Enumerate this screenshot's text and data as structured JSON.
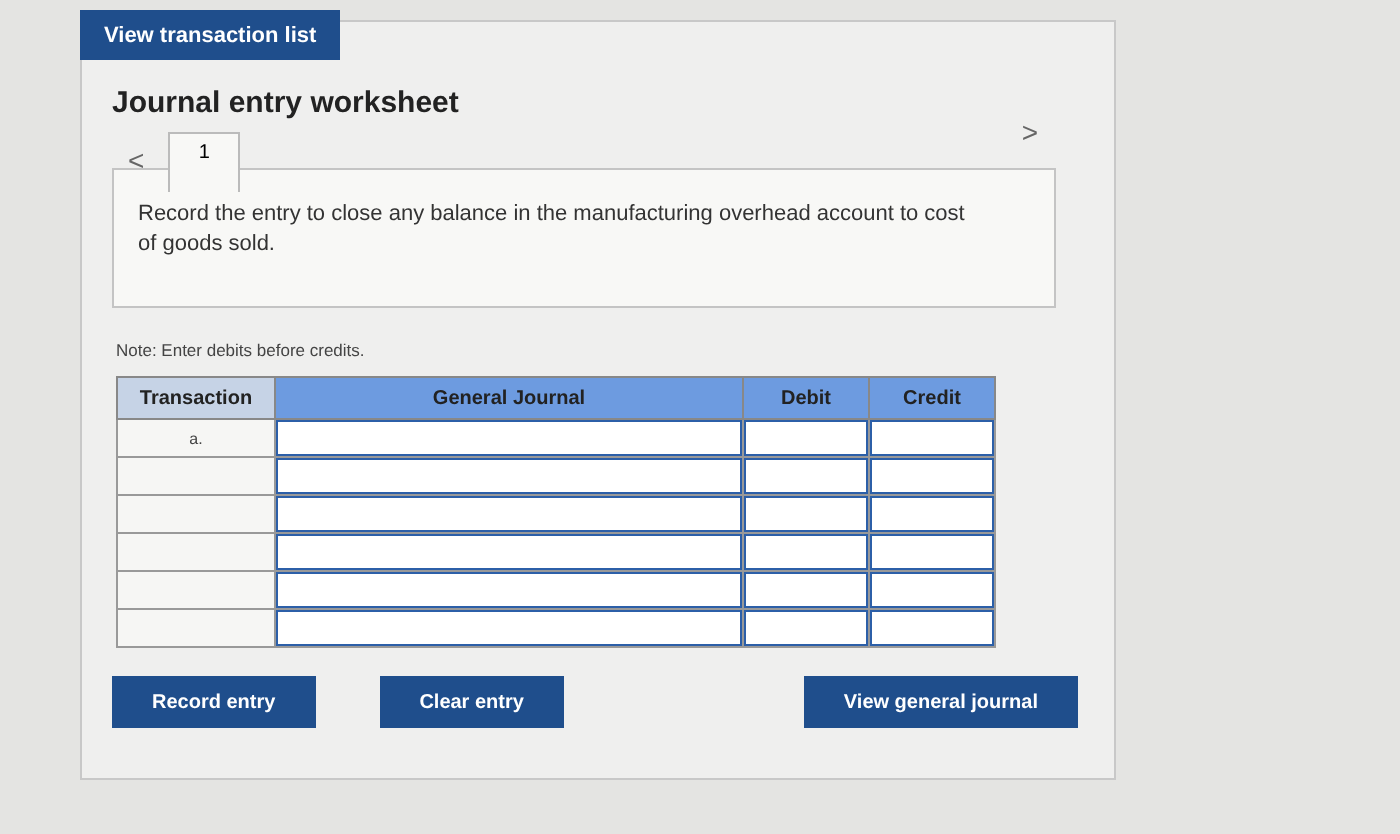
{
  "top_button": "View transaction list",
  "worksheet": {
    "title": "Journal entry worksheet",
    "prev": "<",
    "next": ">",
    "tabs": [
      {
        "label": "1",
        "selected": true
      }
    ],
    "instruction": "Record the entry to close any balance in the manufacturing overhead account to cost of goods sold.",
    "note": "Note: Enter debits before credits.",
    "table": {
      "columns": [
        "Transaction",
        "General Journal",
        "Debit",
        "Credit"
      ],
      "rows": [
        {
          "transaction": "a."
        },
        {},
        {},
        {},
        {},
        {}
      ]
    },
    "buttons": [
      {
        "label": "Record entry"
      },
      {
        "label": "Clear entry"
      },
      {
        "label": "View general journal"
      }
    ]
  }
}
